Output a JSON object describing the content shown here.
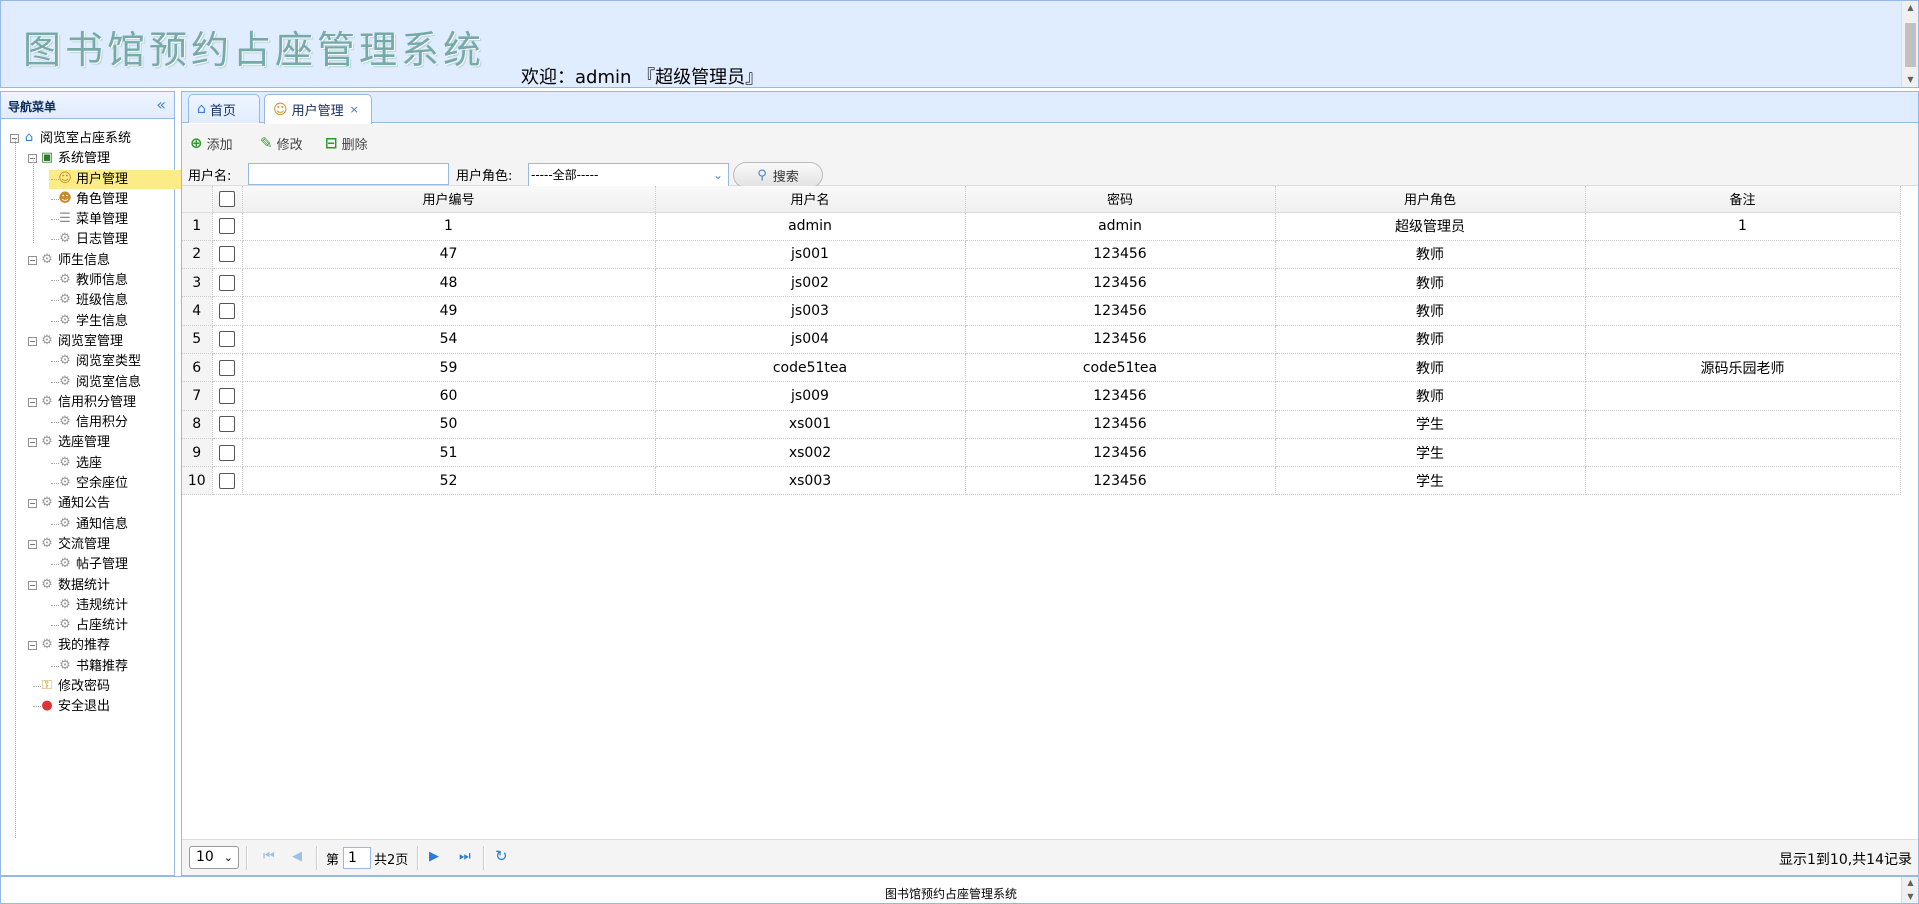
{
  "header": {
    "app_title": "图书馆预约占座管理系统",
    "welcome": "欢迎：admin 『超级管理员』"
  },
  "nav": {
    "title": "导航菜单",
    "collapse_icon": "double-chevron-left-icon",
    "tree": [
      {
        "label": "阅览室占座系统",
        "level": 0,
        "icon": "home-icon"
      },
      {
        "label": "系统管理",
        "level": 1,
        "icon": "book-icon"
      },
      {
        "label": "用户管理",
        "level": 2,
        "icon": "user-icon",
        "selected": true
      },
      {
        "label": "角色管理",
        "level": 2,
        "icon": "role-icon"
      },
      {
        "label": "菜单管理",
        "level": 2,
        "icon": "menu-icon"
      },
      {
        "label": "日志管理",
        "level": 2,
        "icon": "gear-icon"
      },
      {
        "label": "师生信息",
        "level": 1,
        "icon": "gear-icon"
      },
      {
        "label": "教师信息",
        "level": 2,
        "icon": "gear-icon"
      },
      {
        "label": "班级信息",
        "level": 2,
        "icon": "gear-icon"
      },
      {
        "label": "学生信息",
        "level": 2,
        "icon": "gear-icon"
      },
      {
        "label": "阅览室管理",
        "level": 1,
        "icon": "gear-icon"
      },
      {
        "label": "阅览室类型",
        "level": 2,
        "icon": "gear-icon"
      },
      {
        "label": "阅览室信息",
        "level": 2,
        "icon": "gear-icon"
      },
      {
        "label": "信用积分管理",
        "level": 1,
        "icon": "gear-icon"
      },
      {
        "label": "信用积分",
        "level": 2,
        "icon": "gear-icon"
      },
      {
        "label": "选座管理",
        "level": 1,
        "icon": "gear-icon"
      },
      {
        "label": "选座",
        "level": 2,
        "icon": "gear-icon"
      },
      {
        "label": "空余座位",
        "level": 2,
        "icon": "gear-icon"
      },
      {
        "label": "通知公告",
        "level": 1,
        "icon": "gear-icon"
      },
      {
        "label": "通知信息",
        "level": 2,
        "icon": "gear-icon"
      },
      {
        "label": "交流管理",
        "level": 1,
        "icon": "gear-icon"
      },
      {
        "label": "帖子管理",
        "level": 2,
        "icon": "gear-icon"
      },
      {
        "label": "数据统计",
        "level": 1,
        "icon": "gear-icon"
      },
      {
        "label": "违规统计",
        "level": 2,
        "icon": "gear-icon"
      },
      {
        "label": "占座统计",
        "level": 2,
        "icon": "gear-icon"
      },
      {
        "label": "我的推荐",
        "level": 1,
        "icon": "gear-icon"
      },
      {
        "label": "书籍推荐",
        "level": 2,
        "icon": "gear-icon"
      },
      {
        "label": "修改密码",
        "level": 1,
        "icon": "lock-icon"
      },
      {
        "label": "安全退出",
        "level": 1,
        "icon": "exit-icon"
      }
    ]
  },
  "tabs": [
    {
      "label": "首页",
      "icon": "home-icon"
    },
    {
      "label": "用户管理",
      "icon": "user-icon",
      "close": "×"
    }
  ],
  "toolbar": {
    "add_label": "添加",
    "edit_label": "修改",
    "delete_label": "删除",
    "username_label": "用户名:",
    "username_value": "",
    "role_label": "用户角色:",
    "role_value": "-----全部-----",
    "search_label": "搜索"
  },
  "grid": {
    "columns": [
      "用户编号",
      "用户名",
      "密码",
      "用户角色",
      "备注"
    ],
    "rows": [
      {
        "n": "1",
        "id": "1",
        "name": "admin",
        "pwd": "admin",
        "role": "超级管理员",
        "note": "1"
      },
      {
        "n": "2",
        "id": "47",
        "name": "js001",
        "pwd": "123456",
        "role": "教师",
        "note": ""
      },
      {
        "n": "3",
        "id": "48",
        "name": "js002",
        "pwd": "123456",
        "role": "教师",
        "note": ""
      },
      {
        "n": "4",
        "id": "49",
        "name": "js003",
        "pwd": "123456",
        "role": "教师",
        "note": ""
      },
      {
        "n": "5",
        "id": "54",
        "name": "js004",
        "pwd": "123456",
        "role": "教师",
        "note": ""
      },
      {
        "n": "6",
        "id": "59",
        "name": "code51tea",
        "pwd": "code51tea",
        "role": "教师",
        "note": "源码乐园老师"
      },
      {
        "n": "7",
        "id": "60",
        "name": "js009",
        "pwd": "123456",
        "role": "教师",
        "note": ""
      },
      {
        "n": "8",
        "id": "50",
        "name": "xs001",
        "pwd": "123456",
        "role": "学生",
        "note": ""
      },
      {
        "n": "9",
        "id": "51",
        "name": "xs002",
        "pwd": "123456",
        "role": "学生",
        "note": ""
      },
      {
        "n": "10",
        "id": "52",
        "name": "xs003",
        "pwd": "123456",
        "role": "学生",
        "note": ""
      }
    ]
  },
  "pager": {
    "page_size": "10",
    "page_prefix": "第",
    "page_number": "1",
    "page_total": "共2页",
    "info": "显示1到10,共14记录"
  },
  "footer": {
    "text": "图书馆预约占座管理系统"
  },
  "colors": {
    "panel_bg": "#e0ecff",
    "border": "#95b8e7",
    "selected": "#fbec88",
    "title": "#76a9a9"
  }
}
